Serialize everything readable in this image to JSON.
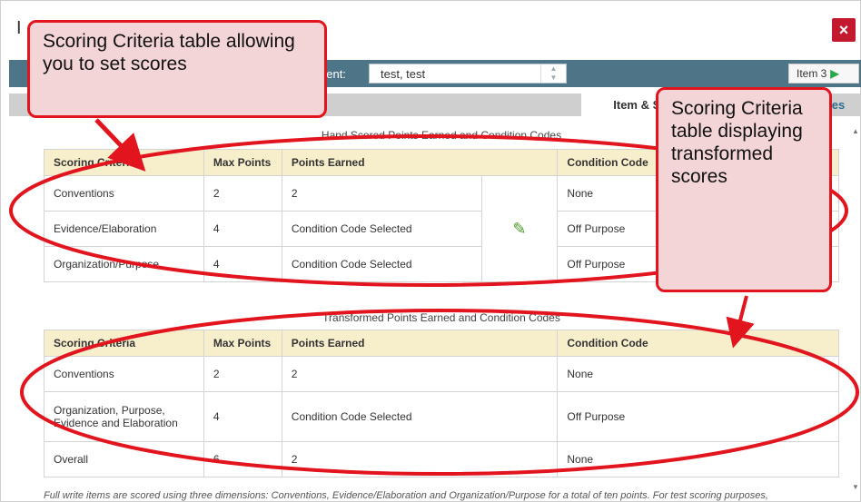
{
  "modal": {
    "title": "I",
    "close_label": "×"
  },
  "toolbar": {
    "student_label": "dent:",
    "student_value": "test, test",
    "item_nav_label": "Item 3",
    "item_nav_arrow": "▶"
  },
  "tabs": [
    {
      "label": "Item & Score",
      "active": true
    },
    {
      "label": "Rubric & Resources",
      "active": false
    }
  ],
  "hand_scored": {
    "caption": "Hand Scored Points Earned and Condition Codes",
    "headers": [
      "Scoring Criteria",
      "Max Points",
      "Points Earned",
      "Condition Code"
    ],
    "rows": [
      {
        "criteria": "Conventions",
        "max": "2",
        "earned": "2",
        "code": "None"
      },
      {
        "criteria": "Evidence/Elaboration",
        "max": "4",
        "earned": "Condition Code Selected",
        "code": "Off Purpose"
      },
      {
        "criteria": "Organization/Purpose",
        "max": "4",
        "earned": "Condition Code Selected",
        "code": "Off Purpose"
      }
    ],
    "edit_icon": "pencil-icon"
  },
  "transformed": {
    "caption": "Transformed Points Earned and Condition Codes",
    "headers": [
      "Scoring Criteria",
      "Max Points",
      "Points Earned",
      "Condition Code"
    ],
    "rows": [
      {
        "criteria": "Conventions",
        "max": "2",
        "earned": "2",
        "code": "None"
      },
      {
        "criteria": "Organization, Purpose, Evidence and Elaboration",
        "max": "4",
        "earned": "Condition Code Selected",
        "code": "Off Purpose"
      },
      {
        "criteria": "Overall",
        "max": "6",
        "earned": "2",
        "code": "None"
      }
    ]
  },
  "footnote": "Full write items are scored using three dimensions: Conventions, Evidence/Elaboration and Organization/Purpose for a total of ten points. For test scoring purposes,",
  "callouts": {
    "left": "Scoring Criteria table allowing you to set scores",
    "right": "Scoring Criteria table displaying transformed scores"
  },
  "colors": {
    "toolbar": "#4e7488",
    "header_bg": "#f7efcc",
    "close_btn": "#c3182e",
    "annotation_red": "#e2141d",
    "callout_bg": "#f3d5d8"
  }
}
